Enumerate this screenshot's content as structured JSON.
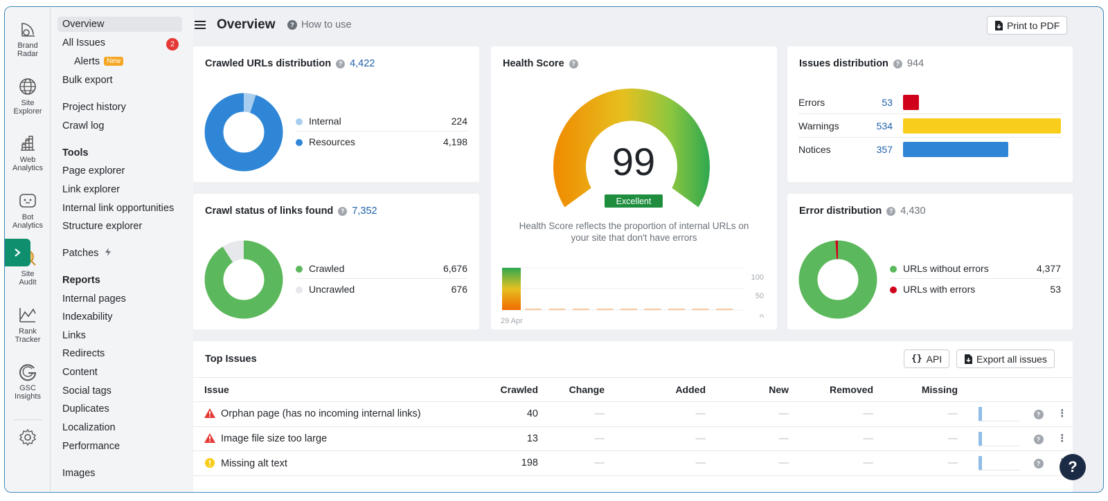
{
  "rail": [
    {
      "label1": "Brand",
      "label2": "Radar",
      "icon": "brand-radar-icon"
    },
    {
      "label1": "Site",
      "label2": "Explorer",
      "icon": "globe-icon"
    },
    {
      "label1": "Web",
      "label2": "Analytics",
      "icon": "web-analytics-icon"
    },
    {
      "label1": "Bot",
      "label2": "Analytics",
      "icon": "bot-icon"
    },
    {
      "label1": "Site",
      "label2": "Audit",
      "icon": "site-audit-icon"
    },
    {
      "label1": "Rank",
      "label2": "Tracker",
      "icon": "rank-tracker-icon"
    },
    {
      "label1": "GSC",
      "label2": "Insights",
      "icon": "gsc-icon"
    }
  ],
  "nav": {
    "overview": "Overview",
    "all_issues": "All Issues",
    "all_issues_badge": "2",
    "alerts": "Alerts",
    "alerts_badge": "New",
    "bulk_export": "Bulk export",
    "project_history": "Project history",
    "crawl_log": "Crawl log",
    "tools_heading": "Tools",
    "page_explorer": "Page explorer",
    "link_explorer": "Link explorer",
    "internal_link_opportunities": "Internal link opportunities",
    "structure_explorer": "Structure explorer",
    "patches": "Patches",
    "reports_heading": "Reports",
    "internal_pages": "Internal pages",
    "indexability": "Indexability",
    "links": "Links",
    "redirects": "Redirects",
    "content": "Content",
    "social_tags": "Social tags",
    "duplicates": "Duplicates",
    "localization": "Localization",
    "performance": "Performance",
    "images": "Images"
  },
  "header": {
    "title": "Overview",
    "how_to_use": "How to use",
    "print_pdf": "Print to PDF"
  },
  "crawled": {
    "title": "Crawled URLs distribution",
    "total": "4,422",
    "rows": [
      {
        "label": "Internal",
        "value": "224",
        "num": 224,
        "color": "#a8cdef"
      },
      {
        "label": "Resources",
        "value": "4,198",
        "num": 4198,
        "color": "#2f86d6"
      }
    ]
  },
  "crawl_status": {
    "title": "Crawl status of links found",
    "total": "7,352",
    "rows": [
      {
        "label": "Crawled",
        "value": "6,676",
        "num": 6676,
        "color": "#5cb85c"
      },
      {
        "label": "Uncrawled",
        "value": "676",
        "num": 676,
        "color": "#e6e8eb"
      }
    ]
  },
  "health": {
    "title": "Health Score",
    "score": "99",
    "score_num": 99,
    "rating": "Excellent",
    "desc1": "Health Score reflects the proportion of internal URLs on",
    "desc2": "your site that don't have errors",
    "axis": [
      "100",
      "50",
      "0"
    ],
    "date": "29 Apr"
  },
  "issues_dist": {
    "title": "Issues distribution",
    "total": "944",
    "rows": [
      {
        "label": "Errors",
        "value": "53",
        "num": 53,
        "color": "#d0021b"
      },
      {
        "label": "Warnings",
        "value": "534",
        "num": 534,
        "color": "#f8cd1c"
      },
      {
        "label": "Notices",
        "value": "357",
        "num": 357,
        "color": "#2f86d6"
      }
    ]
  },
  "error_dist": {
    "title": "Error distribution",
    "total": "4,430",
    "rows": [
      {
        "label": "URLs without errors",
        "value": "4,377",
        "num": 4377,
        "color": "#5cb85c"
      },
      {
        "label": "URLs with errors",
        "value": "53",
        "num": 53,
        "color": "#d0021b"
      }
    ]
  },
  "top_issues": {
    "title": "Top Issues",
    "api_label": "API",
    "export_label": "Export all issues",
    "columns": [
      "Issue",
      "Crawled",
      "Change",
      "Added",
      "New",
      "Removed",
      "Missing"
    ],
    "dash": "—",
    "rows": [
      {
        "issue": "Orphan page (has no incoming internal links)",
        "crawled": "40",
        "severity": "error"
      },
      {
        "issue": "Image file size too large",
        "crawled": "13",
        "severity": "error"
      },
      {
        "issue": "Missing alt text",
        "crawled": "198",
        "severity": "warning"
      }
    ]
  },
  "help_button": "?"
}
